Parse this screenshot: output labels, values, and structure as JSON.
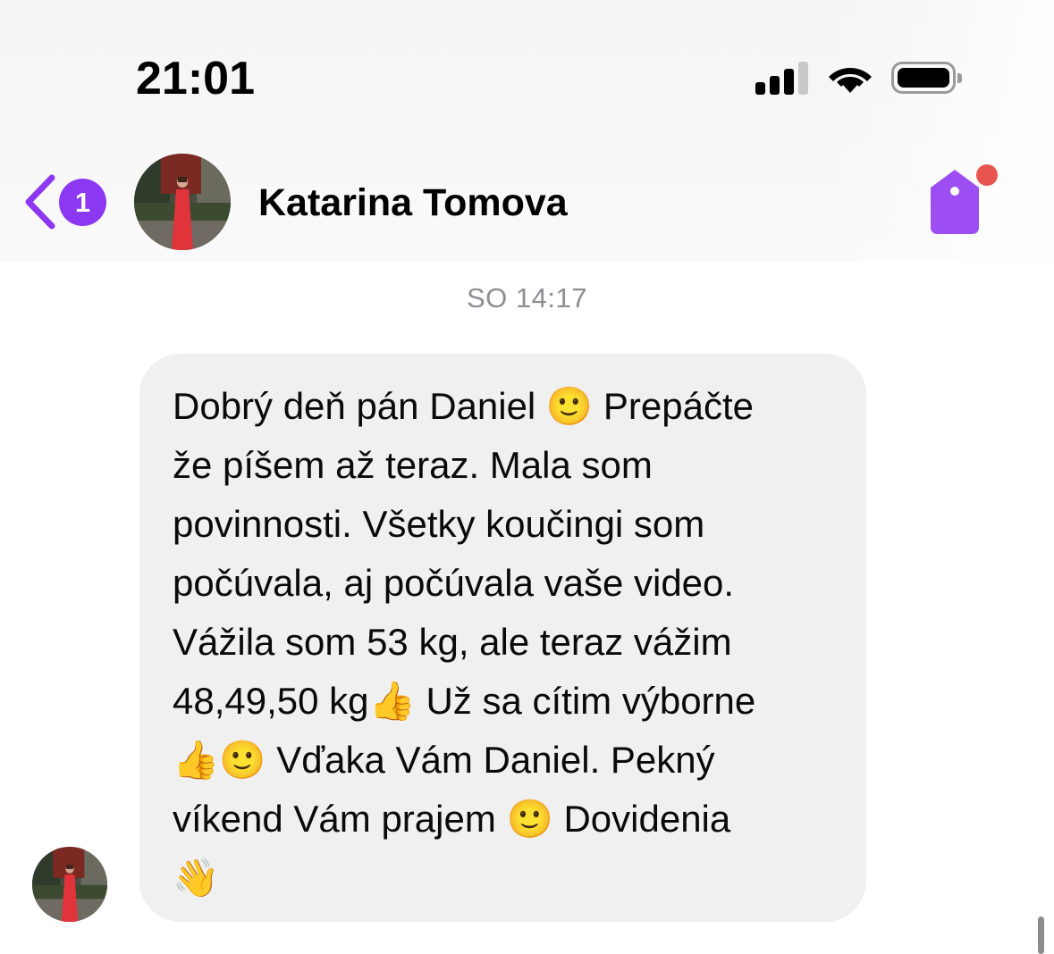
{
  "status_bar": {
    "time": "21:01"
  },
  "header": {
    "back_badge_count": "1",
    "contact_name": "Katarina Tomova",
    "tag_has_notification": true
  },
  "conversation": {
    "timestamp": "SO 14:17",
    "messages": [
      {
        "lines": [
          "Dobrý deň pán Daniel 🙂 Prepáčte",
          "že píšem až teraz. Mala som",
          "povinnosti. Všetky koučingi som",
          "počúvala, aj počúvala vaše video.",
          "Vážila som 53 kg, ale teraz vážim",
          "48,49,50 kg👍 Už sa cítim výborne",
          "👍🙂 Vďaka Vám Daniel. Pekný",
          "víkend Vám prajem 🙂 Dovidenia",
          "👋"
        ]
      }
    ]
  },
  "colors": {
    "accent": "#8c37f2",
    "bubble": "#f0f0f0",
    "notification_dot": "#e8544e",
    "timestamp": "#8e8e93"
  },
  "icons": {
    "back": "chevron-left-icon",
    "tag": "tag-icon",
    "signal": "cellular-signal-icon",
    "wifi": "wifi-icon",
    "battery": "battery-icon"
  }
}
